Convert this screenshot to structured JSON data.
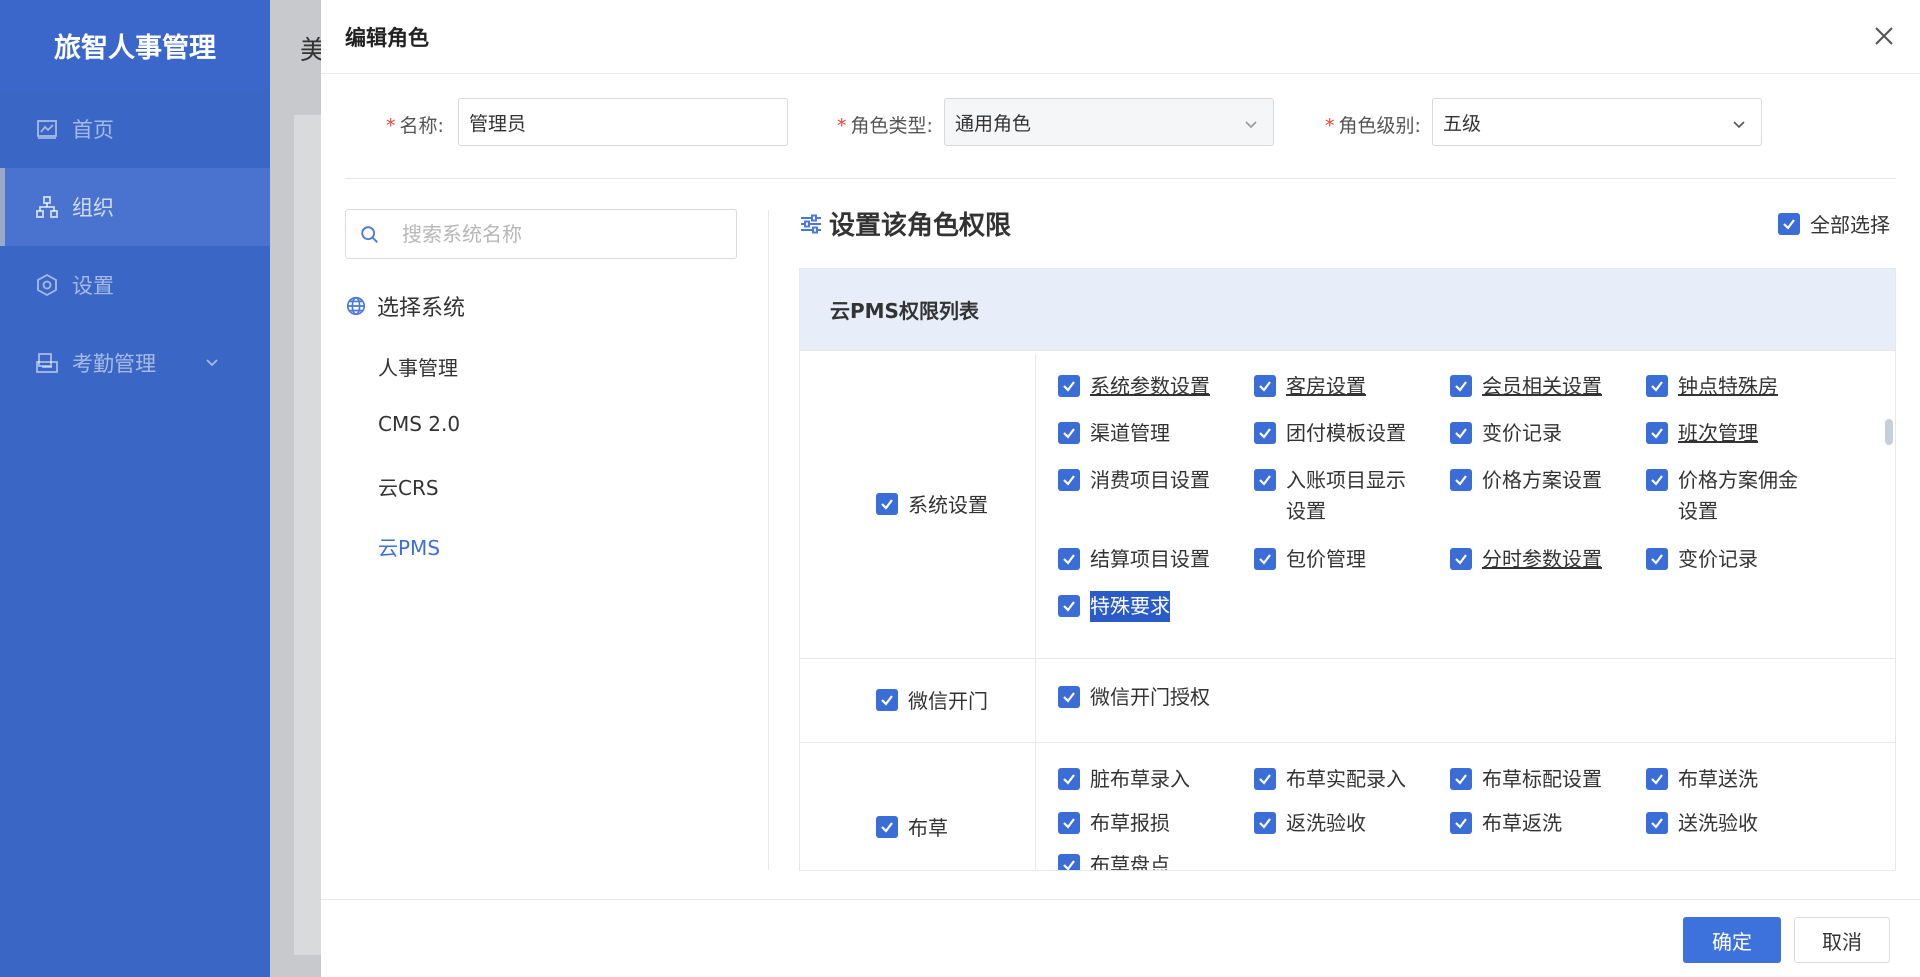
{
  "app": {
    "brand": "旅智人事管理",
    "background_title_fragment": "美"
  },
  "sidebar": {
    "items": [
      {
        "label": "首页",
        "icon": "chart-icon"
      },
      {
        "label": "组织",
        "icon": "org-icon"
      },
      {
        "label": "设置",
        "icon": "settings-icon"
      },
      {
        "label": "考勤管理",
        "icon": "attendance-icon"
      }
    ]
  },
  "drawer": {
    "title": "编辑角色",
    "form": {
      "name_label": "名称:",
      "name_value": "管理员",
      "type_label": "角色类型:",
      "type_value": "通用角色",
      "level_label": "角色级别:",
      "level_value": "五级"
    },
    "search": {
      "placeholder": "搜索系统名称"
    },
    "systems": {
      "heading": "选择系统",
      "items": [
        "人事管理",
        "CMS 2.0",
        "云CRS",
        "云PMS"
      ],
      "active": "云PMS"
    },
    "permissions": {
      "heading": "设置该角色权限",
      "select_all": "全部选择",
      "table_title": "云PMS权限列表",
      "groups": [
        {
          "name": "系统设置",
          "items": [
            "系统参数设置",
            "客房设置",
            "会员相关设置",
            "钟点特殊房",
            "渠道管理",
            "团付模板设置",
            "变价记录",
            "班次管理",
            "消费项目设置",
            "入账项目显示设置",
            "价格方案设置",
            "价格方案佣金设置",
            "结算项目设置",
            "包价管理",
            "分时参数设置",
            "变价记录",
            "特殊要求"
          ]
        },
        {
          "name": "微信开门",
          "items": [
            "微信开门授权"
          ]
        },
        {
          "name": "布草",
          "items": [
            "脏布草录入",
            "布草实配录入",
            "布草标配设置",
            "布草送洗",
            "布草报损",
            "返洗验收",
            "布草返洗",
            "送洗验收",
            "布草盘点"
          ]
        }
      ]
    },
    "footer": {
      "confirm": "确定",
      "cancel": "取消"
    }
  },
  "colors": {
    "primary": "#3d72dc",
    "sidebar_bg": "#3a66c6",
    "checkbox": "#3b6dd7",
    "table_head_bg": "#e8eef9",
    "required": "#e5453b"
  }
}
